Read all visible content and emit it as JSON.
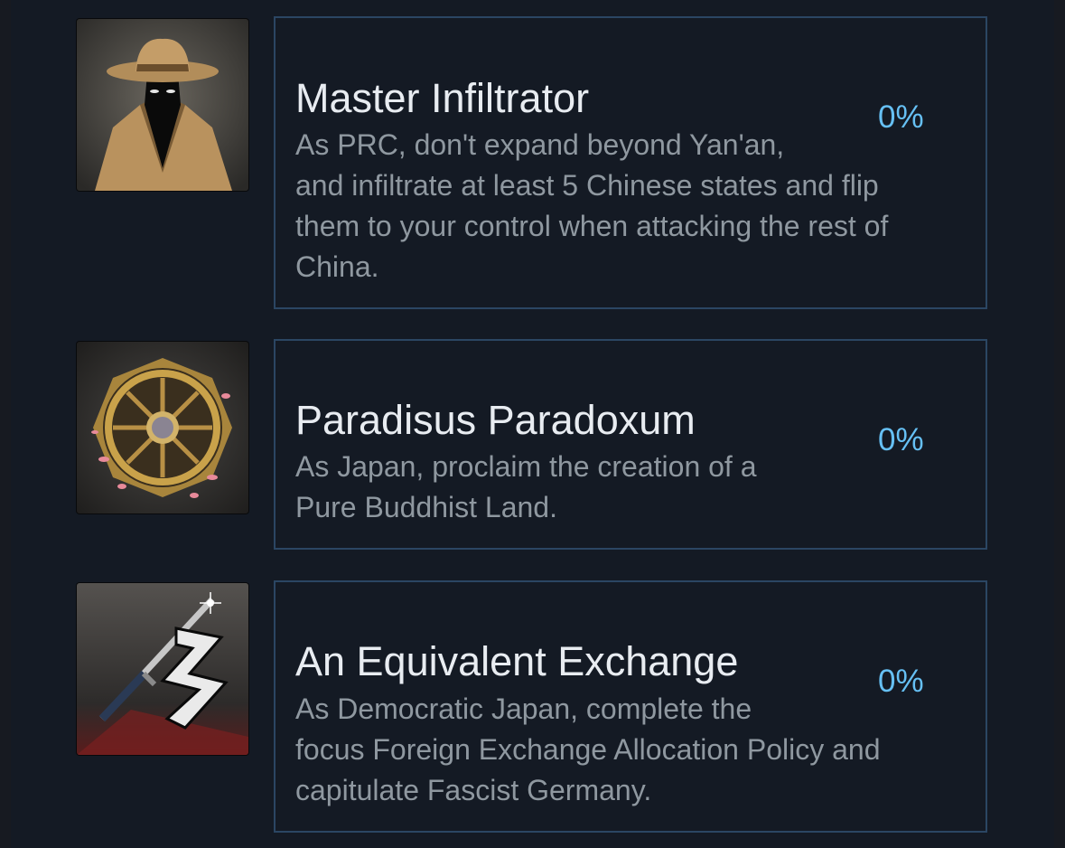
{
  "achievements": [
    {
      "icon": "spy-icon",
      "title": "Master Infiltrator",
      "desc1": "As PRC, don't expand beyond Yan'an,",
      "desc2": "and infiltrate at least 5 Chinese states and flip",
      "desc3": "them to your control when attacking the rest of",
      "desc4": "China.",
      "percent": "0%"
    },
    {
      "icon": "dharma-wheel-icon",
      "title": "Paradisus Paradoxum",
      "desc1": "As Japan, proclaim the creation of a",
      "desc2": "Pure Buddhist Land.",
      "percent": "0%"
    },
    {
      "icon": "katana-icon",
      "title": "An Equivalent Exchange",
      "desc1": "As Democratic Japan, complete the",
      "desc2": "focus Foreign Exchange Allocation Policy and",
      "desc3": "capitulate Fascist Germany.",
      "percent": "0%"
    }
  ]
}
